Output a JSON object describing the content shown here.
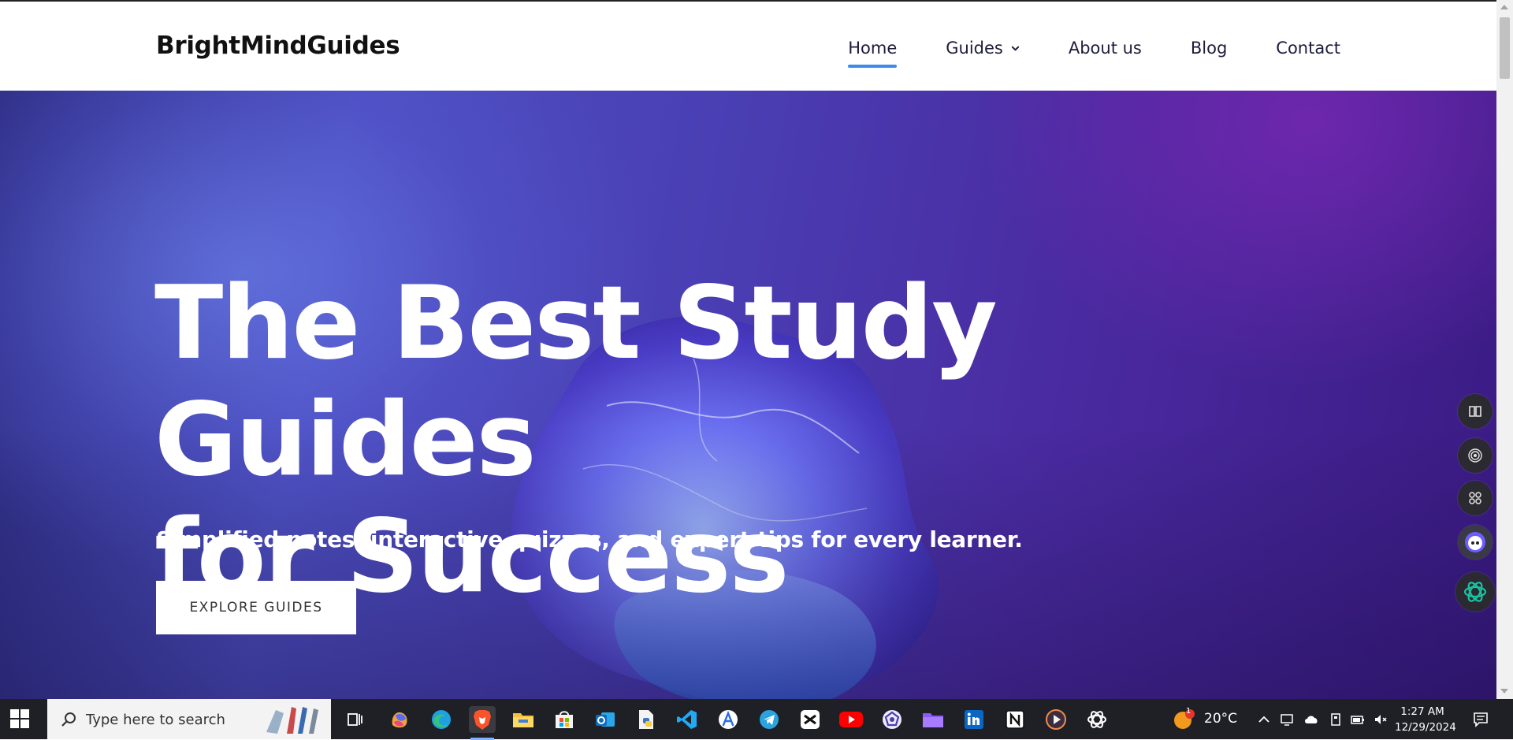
{
  "brand": "BrightMindGuides",
  "nav": {
    "home": "Home",
    "guides": "Guides",
    "about": "About us",
    "blog": "Blog",
    "contact": "Contact"
  },
  "hero": {
    "title_line1": "The Best Study Guides",
    "title_line2": "for Success",
    "subtitle": "Simplified notes, interactive quizzes, and expert tips for every learner.",
    "cta": "EXPLORE GUIDES"
  },
  "colors": {
    "nav_active_underline": "#3a8ce8",
    "hero_gradient": [
      "#2a2a7c",
      "#4c4fc0",
      "#4a2aa0",
      "#3a1a82"
    ],
    "taskbar": "#1f1f26"
  },
  "side_dock": {
    "icons": [
      "book-icon",
      "broadcast-icon",
      "command-icon",
      "bot-face-icon",
      "chatgpt-icon"
    ]
  },
  "taskbar": {
    "search_placeholder": "Type here to search",
    "apps": [
      "task-view-icon",
      "copilot-icon",
      "edge-icon",
      "brave-icon",
      "file-explorer-icon",
      "microsoft-store-icon",
      "outlook-icon",
      "python-file-icon",
      "vscode-icon",
      "arc-browser-icon",
      "telegram-icon",
      "capcut-icon",
      "youtube-icon",
      "network-app-icon",
      "folder-icon",
      "linkedin-icon",
      "notion-icon",
      "media-player-icon",
      "chatgpt-icon"
    ],
    "active_app": "brave-icon",
    "weather": "20°C",
    "weather_badge": "1",
    "time": "1:27 AM",
    "date": "12/29/2024"
  }
}
